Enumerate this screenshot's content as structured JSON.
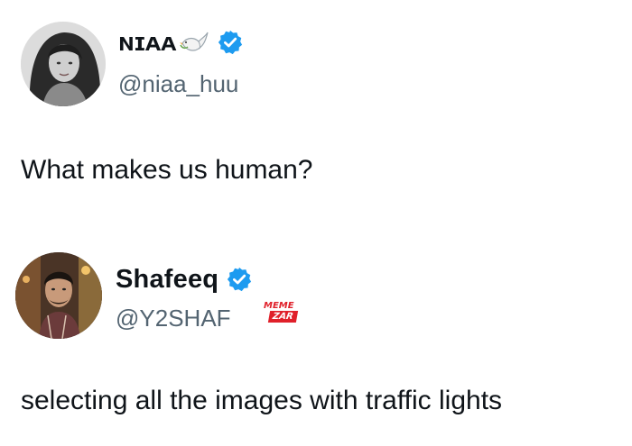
{
  "tweets": [
    {
      "display_name": "ɴɪᴀᴀ",
      "handle": "@niaa_huu",
      "text": "What makes us human?",
      "verified": true,
      "verified_color": "#1d9bf0"
    },
    {
      "display_name": "Shafeeq",
      "handle": "@Y2SHAF",
      "text": "selecting all the images with traffic lights",
      "verified": true,
      "verified_color": "#1d9bf0"
    }
  ],
  "watermark": {
    "top": "MEME",
    "bottom": "ZAR",
    "color": "#e0202a"
  }
}
